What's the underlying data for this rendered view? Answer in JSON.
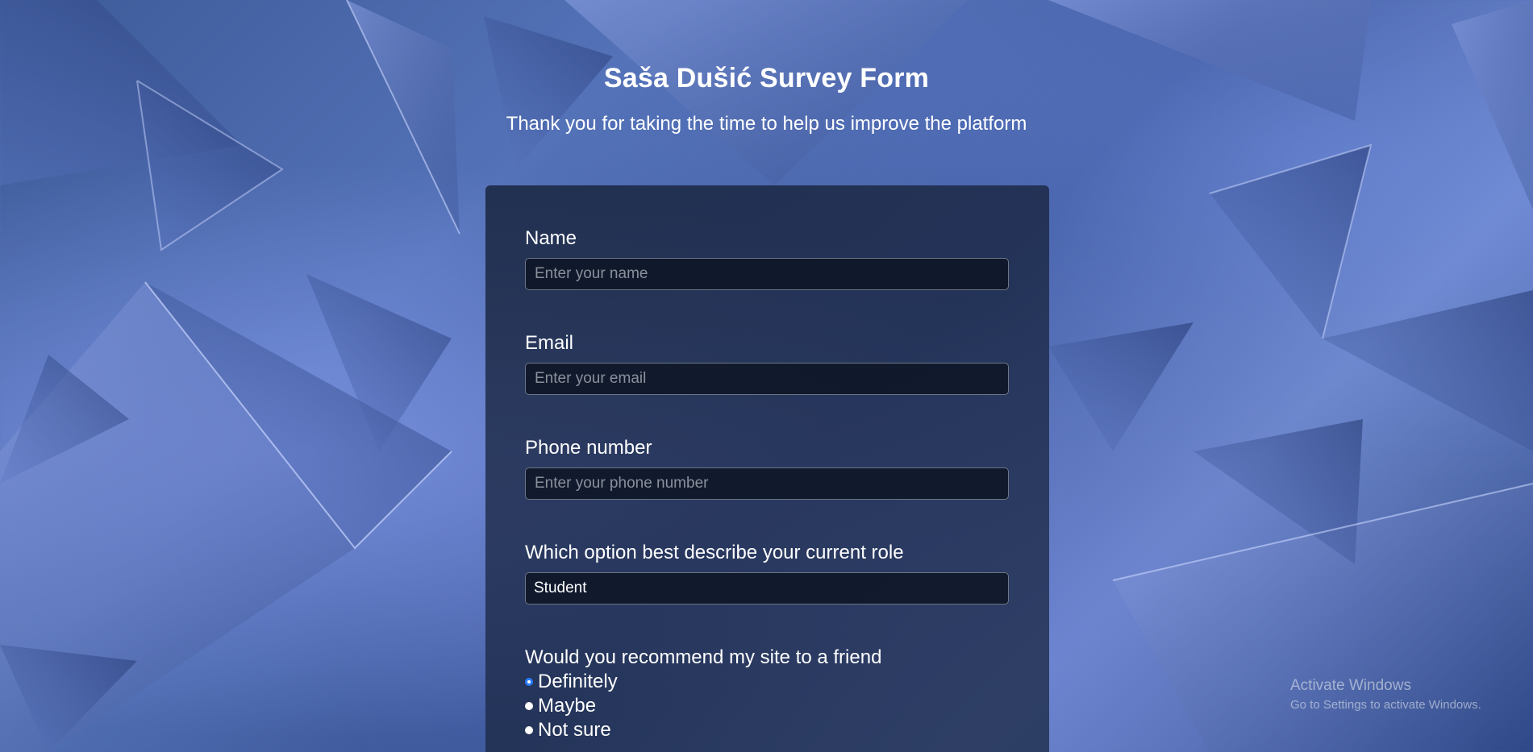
{
  "header": {
    "title": "Saša Dušić Survey Form",
    "subtitle": "Thank you for taking the time to help us improve the platform"
  },
  "form": {
    "name": {
      "label": "Name",
      "placeholder": "Enter your name"
    },
    "email": {
      "label": "Email",
      "placeholder": "Enter your email"
    },
    "phone": {
      "label": "Phone number",
      "placeholder": "Enter your phone number"
    },
    "role": {
      "label": "Which option best describe your current role",
      "selected": "Student"
    },
    "recommend": {
      "label": "Would you recommend my site to a friend",
      "options": [
        "Definitely",
        "Maybe",
        "Not sure"
      ],
      "selected_index": 0
    }
  },
  "watermark": {
    "title": "Activate Windows",
    "subtitle": "Go to Settings to activate Windows."
  },
  "colors": {
    "card_bg": "#1b2742",
    "radio_selected_ring": "#2b7bff",
    "text": "#ffffff"
  }
}
